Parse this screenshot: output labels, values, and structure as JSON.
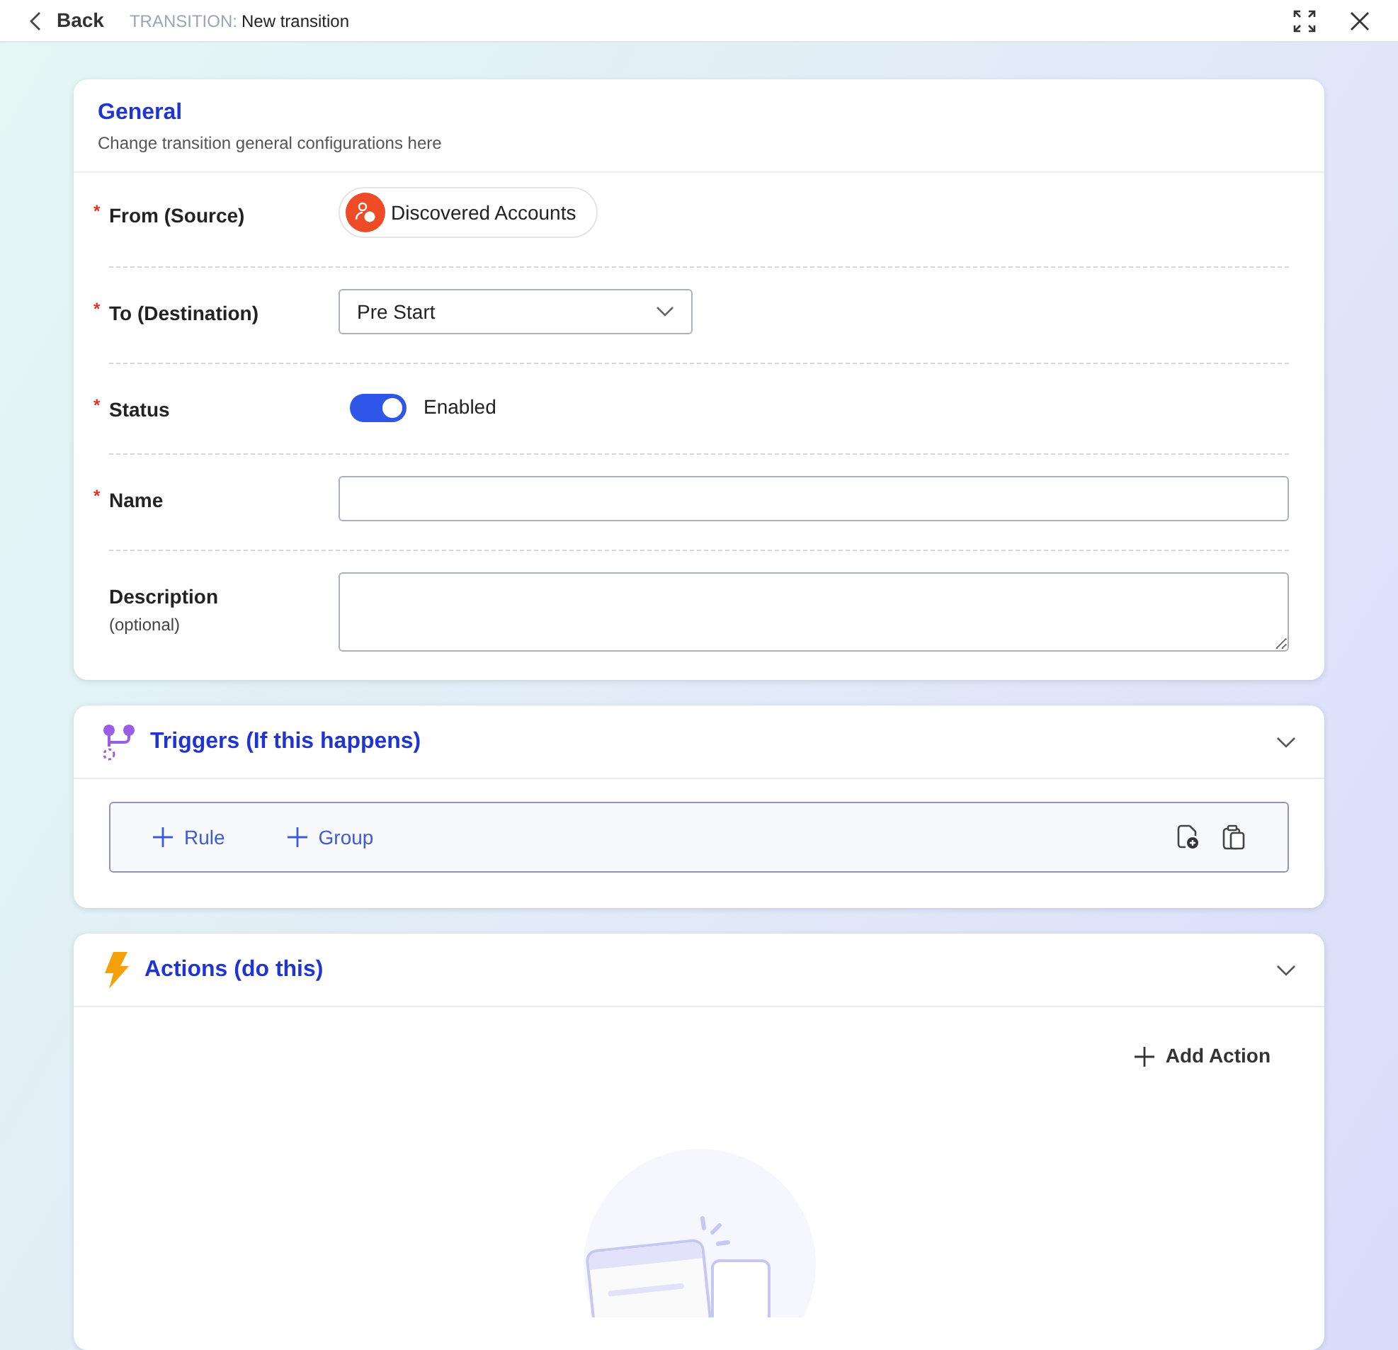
{
  "header": {
    "back": "Back",
    "context_label": "TRANSITION:",
    "context_value": "New transition"
  },
  "general": {
    "title": "General",
    "subtitle": "Change transition general configurations here",
    "fields": [
      {
        "kind": "chip",
        "label": "From (Source)",
        "required_mark": "*",
        "value": "Discovered Accounts"
      },
      {
        "kind": "select",
        "label": "To (Destination)",
        "required_mark": "*",
        "value": "Pre Start"
      },
      {
        "kind": "toggle",
        "label": "Status",
        "required_mark": "*",
        "on": true,
        "value": "Enabled"
      },
      {
        "kind": "text",
        "label": "Name",
        "required_mark": "*"
      },
      {
        "kind": "textarea",
        "label": "Description",
        "note": "(optional)"
      }
    ]
  },
  "triggers": {
    "title": "Triggers (If this happens)",
    "expanded": true,
    "buttons": [
      "Rule",
      "Group"
    ]
  },
  "actions": {
    "title": "Actions (do this)",
    "expanded": true,
    "add_button": "Add Action"
  }
}
